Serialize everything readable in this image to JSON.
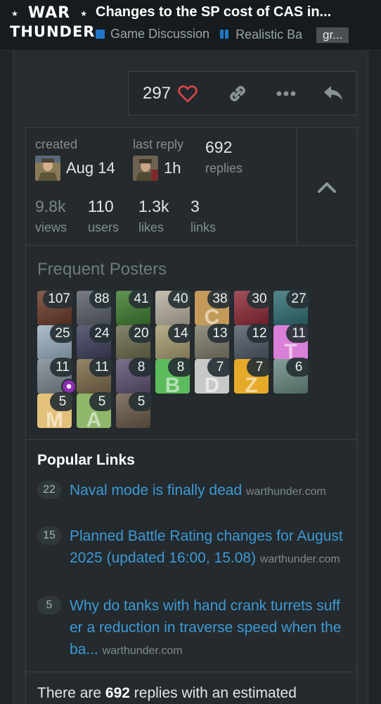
{
  "header": {
    "logo_line1": "WAR",
    "logo_line2": "THUNDER",
    "topic_title": "Changes to the SP cost of CAS in...",
    "breadcrumbs": [
      "Game Discussion",
      "Realistic Ba"
    ],
    "tag": "gr..."
  },
  "post_actions": {
    "like_count": "297"
  },
  "topic_map": {
    "created_label": "created",
    "created_value": "Aug 14",
    "last_reply_label": "last reply",
    "last_reply_value": "1h",
    "replies_value": "692",
    "replies_label": "replies",
    "views_value": "9.8k",
    "views_label": "views",
    "users_value": "110",
    "users_label": "users",
    "likes_value": "1.3k",
    "likes_label": "likes",
    "links_value": "3",
    "links_label": "links"
  },
  "frequent_posters": {
    "title": "Frequent Posters",
    "posters": [
      {
        "count": "107",
        "color": "#6b3a2a",
        "letter": ""
      },
      {
        "count": "88",
        "color": "#5a6068",
        "letter": ""
      },
      {
        "count": "41",
        "color": "#3e7d2e",
        "letter": ""
      },
      {
        "count": "40",
        "color": "#b8b2a0",
        "letter": ""
      },
      {
        "count": "38",
        "color": "#c49a5a",
        "letter": "C"
      },
      {
        "count": "30",
        "color": "#8e2a36",
        "letter": ""
      },
      {
        "count": "27",
        "color": "#2f6e73",
        "letter": ""
      },
      {
        "count": "25",
        "color": "#9ab0c2",
        "letter": ""
      },
      {
        "count": "24",
        "color": "#3d3f5c",
        "letter": ""
      },
      {
        "count": "20",
        "color": "#6b6a4c",
        "letter": ""
      },
      {
        "count": "14",
        "color": "#a89c72",
        "letter": ""
      },
      {
        "count": "13",
        "color": "#7e7a6a",
        "letter": ""
      },
      {
        "count": "12",
        "color": "#4e5a66",
        "letter": ""
      },
      {
        "count": "11",
        "color": "#d980d8",
        "letter": "T"
      },
      {
        "count": "11",
        "color": "#7b8890",
        "letter": ""
      },
      {
        "count": "11",
        "color": "#7a6a48",
        "letter": ""
      },
      {
        "count": "8",
        "color": "#5e5272",
        "letter": ""
      },
      {
        "count": "8",
        "color": "#5cbc5c",
        "letter": "B"
      },
      {
        "count": "7",
        "color": "#c7c9c8",
        "letter": "D"
      },
      {
        "count": "7",
        "color": "#e6aa2a",
        "letter": "Z"
      },
      {
        "count": "6",
        "color": "#6a8a82",
        "letter": ""
      },
      {
        "count": "5",
        "color": "#e3c17a",
        "letter": "M"
      },
      {
        "count": "5",
        "color": "#8fb76a",
        "letter": "A"
      },
      {
        "count": "5",
        "color": "#6b5a48",
        "letter": ""
      }
    ]
  },
  "popular_links": {
    "title": "Popular Links",
    "links": [
      {
        "clicks": "22",
        "text": "Naval mode is finally dead",
        "domain": "warthunder.com"
      },
      {
        "clicks": "15",
        "text": "Planned Battle Rating changes for August 2025 (updated 16:00, 15.08)",
        "domain": "warthunder.com"
      },
      {
        "clicks": "5",
        "text": "Why do tanks with hand crank turrets suffer a reduction in traverse speed when the ba...",
        "domain": "warthunder.com"
      }
    ]
  },
  "footer": {
    "prefix": "There are",
    "count": "692",
    "suffix": "replies with an estimated"
  },
  "colors": {
    "accent_blue": "#3d9ad6",
    "heart_red": "#e0464f",
    "category_blue": "#1f78c7"
  }
}
